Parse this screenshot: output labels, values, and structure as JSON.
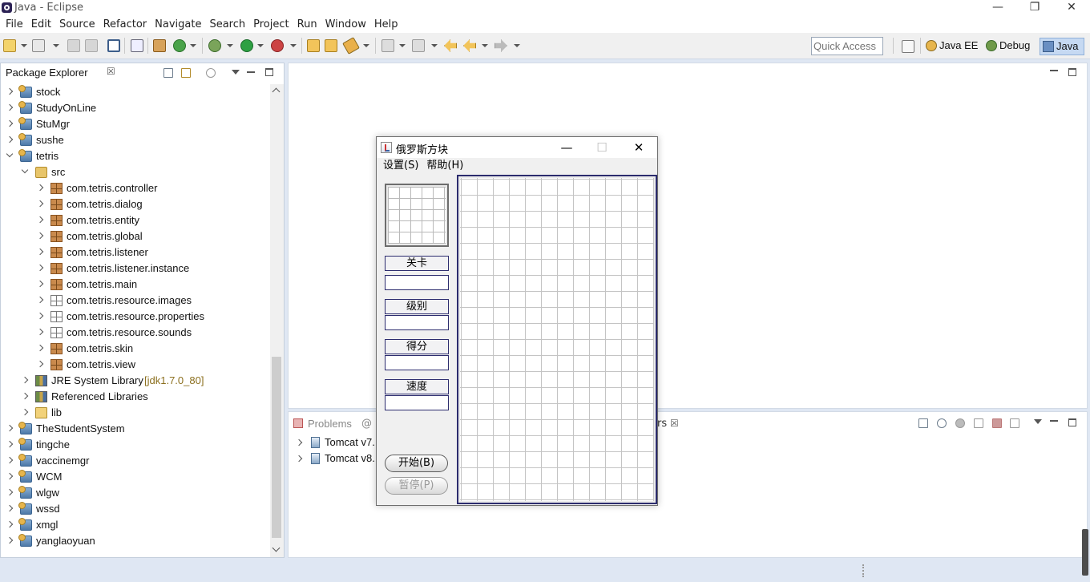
{
  "window": {
    "title": "Java - Eclipse",
    "minimize": "—",
    "restore": "❐",
    "close": "✕"
  },
  "menubar": [
    "File",
    "Edit",
    "Source",
    "Refactor",
    "Navigate",
    "Search",
    "Project",
    "Run",
    "Window",
    "Help"
  ],
  "toolbar": {
    "quick_access_placeholder": "Quick Access",
    "perspectives": [
      {
        "label": "Java EE",
        "icon": "java-ee-perspective-icon"
      },
      {
        "label": "Debug",
        "icon": "debug-perspective-icon"
      },
      {
        "label": "Java",
        "icon": "java-perspective-icon",
        "active": true
      }
    ]
  },
  "package_explorer": {
    "tab_label": "Package Explorer",
    "close_glyph": "☒",
    "items": [
      {
        "label": "stock",
        "level": 0,
        "type": "project",
        "expanded": false
      },
      {
        "label": "StudyOnLine",
        "level": 0,
        "type": "project",
        "expanded": false
      },
      {
        "label": "StuMgr",
        "level": 0,
        "type": "project",
        "expanded": false
      },
      {
        "label": "sushe",
        "level": 0,
        "type": "project",
        "expanded": false
      },
      {
        "label": "tetris",
        "level": 0,
        "type": "project",
        "expanded": true
      },
      {
        "label": "src",
        "level": 1,
        "type": "source-folder",
        "expanded": true
      },
      {
        "label": "com.tetris.controller",
        "level": 2,
        "type": "package"
      },
      {
        "label": "com.tetris.dialog",
        "level": 2,
        "type": "package"
      },
      {
        "label": "com.tetris.entity",
        "level": 2,
        "type": "package"
      },
      {
        "label": "com.tetris.global",
        "level": 2,
        "type": "package"
      },
      {
        "label": "com.tetris.listener",
        "level": 2,
        "type": "package"
      },
      {
        "label": "com.tetris.listener.instance",
        "level": 2,
        "type": "package"
      },
      {
        "label": "com.tetris.main",
        "level": 2,
        "type": "package"
      },
      {
        "label": "com.tetris.resource.images",
        "level": 2,
        "type": "package-empty"
      },
      {
        "label": "com.tetris.resource.properties",
        "level": 2,
        "type": "package-empty"
      },
      {
        "label": "com.tetris.resource.sounds",
        "level": 2,
        "type": "package-empty"
      },
      {
        "label": "com.tetris.skin",
        "level": 2,
        "type": "package"
      },
      {
        "label": "com.tetris.view",
        "level": 2,
        "type": "package"
      },
      {
        "label": "JRE System Library",
        "extra": "[jdk1.7.0_80]",
        "level": 1,
        "type": "library"
      },
      {
        "label": "Referenced Libraries",
        "level": 1,
        "type": "library"
      },
      {
        "label": "lib",
        "level": 1,
        "type": "folder"
      },
      {
        "label": "TheStudentSystem",
        "level": 0,
        "type": "project"
      },
      {
        "label": "tingche",
        "level": 0,
        "type": "project"
      },
      {
        "label": "vaccinemgr",
        "level": 0,
        "type": "project"
      },
      {
        "label": "WCM",
        "level": 0,
        "type": "project"
      },
      {
        "label": "wlgw",
        "level": 0,
        "type": "project"
      },
      {
        "label": "wssd",
        "level": 0,
        "type": "project"
      },
      {
        "label": "xmgl",
        "level": 0,
        "type": "project"
      },
      {
        "label": "yanglaoyuan",
        "level": 0,
        "type": "project"
      }
    ]
  },
  "bottom_panel": {
    "tab_problems": "Problems",
    "tab_partial_at": "@",
    "tab_servers_partial": "rs",
    "close_glyph": "☒",
    "servers": [
      "Tomcat v7.",
      "Tomcat v8."
    ]
  },
  "tetris_window": {
    "title": "俄罗斯方块",
    "menu": [
      "设置(S)",
      "帮助(H)"
    ],
    "labels": {
      "level_card": "关卡",
      "rank": "级别",
      "score": "得分",
      "speed": "速度"
    },
    "buttons": {
      "start": "开始(B)",
      "pause": "暂停(P)"
    }
  },
  "colors": {
    "accent": "#2c2c6e",
    "chrome_bg": "#dfe7f3",
    "toolbar_bg": "#f0f0f0"
  }
}
